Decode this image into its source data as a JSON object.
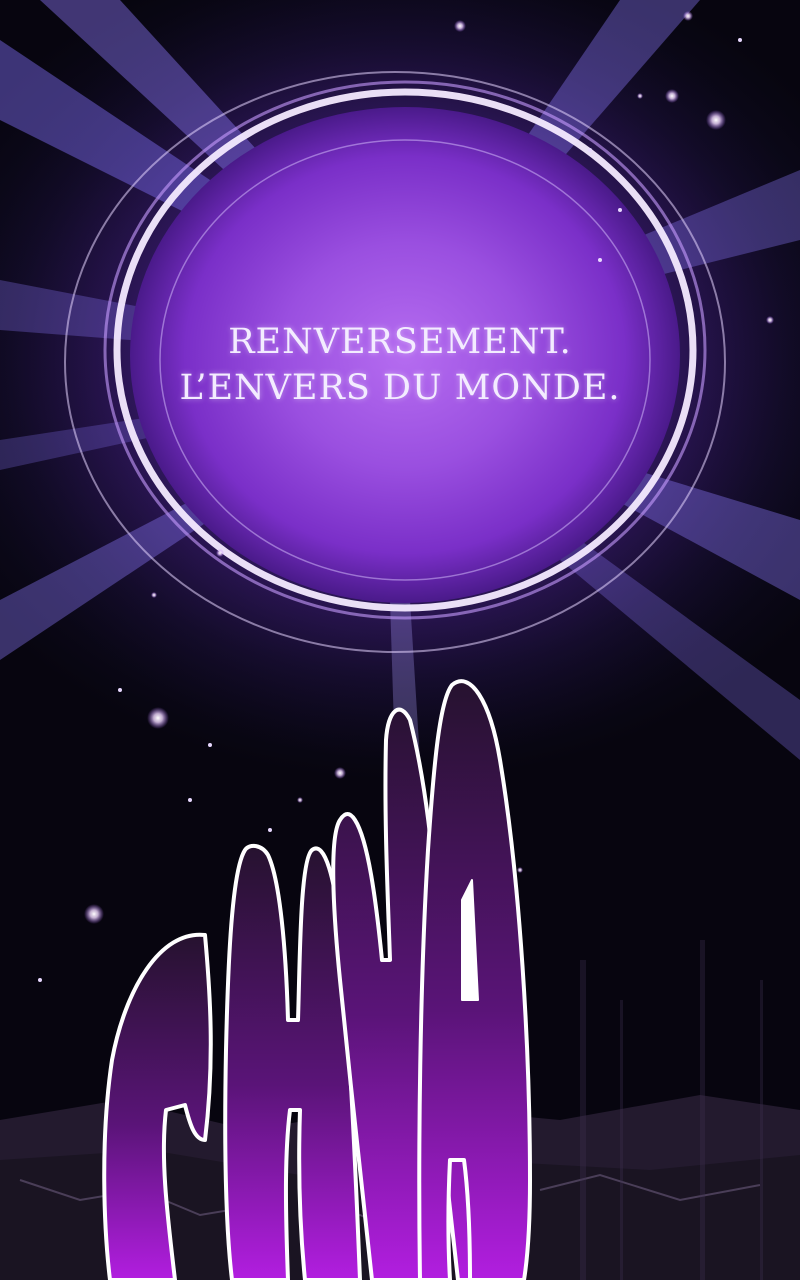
{
  "panel": {
    "caption_lines": [
      "RENVERSEMENT.",
      "L’ENVERS DU MONDE."
    ],
    "sound_effect": "CHWA"
  },
  "colors": {
    "background": "#0a0618",
    "portal_core": "#9a4fe0",
    "portal_ring": "#f0e4ff",
    "light_rays": "#8a78ff",
    "sfx_fill": "#a21fd0",
    "sfx_outline": "#ffffff"
  }
}
